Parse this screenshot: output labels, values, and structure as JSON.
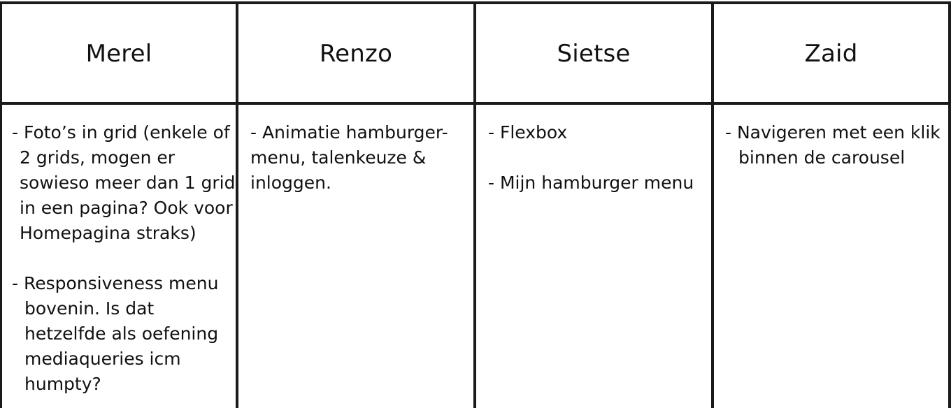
{
  "columns": [
    {
      "name": "Merel",
      "entries": [
        {
          "lines": [
            "- Foto’s in grid (enkele of",
            "2 grids, mogen er",
            "sowieso meer dan 1 grid",
            "in een pagina? Ook voor",
            "Homepagina straks)"
          ]
        },
        {
          "lines": [
            "- Responsiveness menu",
            "bovenin. Is dat",
            "hetzelfde als oefening",
            "mediaqueries icm",
            "humpty?"
          ]
        }
      ]
    },
    {
      "name": "Renzo",
      "entries": [
        {
          "lines": [
            "- Animatie hamburger-",
            "menu, talenkeuze &",
            "inloggen."
          ]
        }
      ]
    },
    {
      "name": "Sietse",
      "entries": [
        {
          "lines": [
            "- Flexbox"
          ]
        },
        {
          "lines": [
            "- Mijn hamburger menu"
          ]
        }
      ]
    },
    {
      "name": "Zaid",
      "entries": [
        {
          "lines": [
            "- Navigeren met een klik",
            "binnen de carousel"
          ]
        }
      ]
    }
  ]
}
